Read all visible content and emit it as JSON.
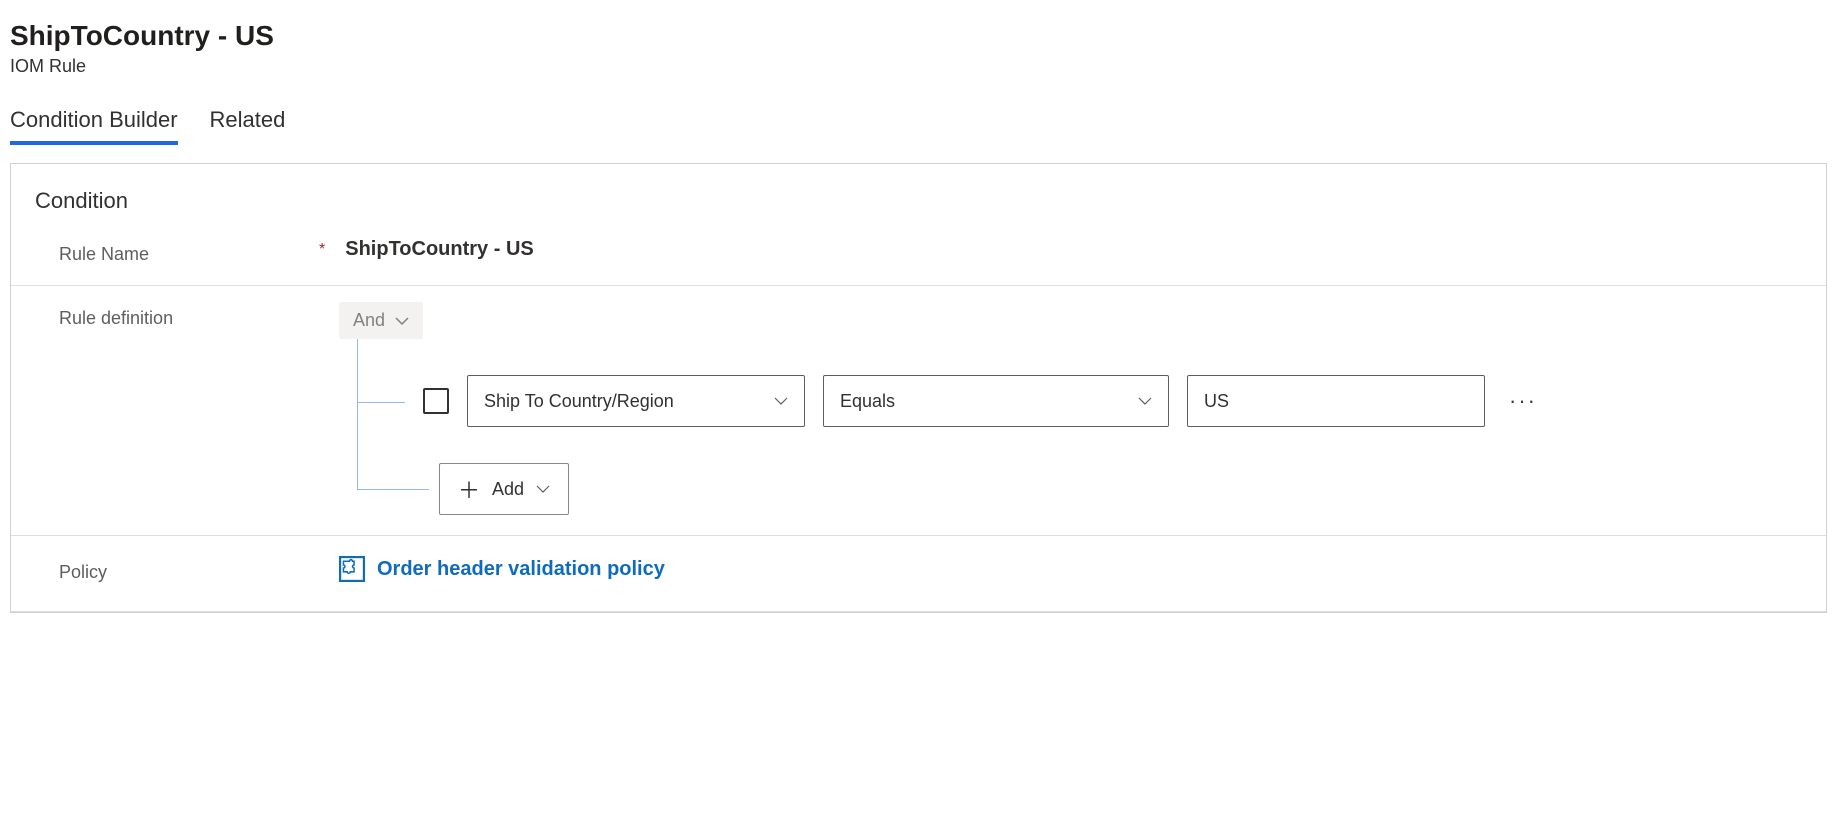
{
  "header": {
    "title": "ShipToCountry - US",
    "subtitle": "IOM Rule"
  },
  "tabs": {
    "condition_builder": "Condition Builder",
    "related": "Related"
  },
  "panel": {
    "heading": "Condition",
    "rule_name_label": "Rule Name",
    "rule_name_value": "ShipToCountry - US",
    "rule_definition_label": "Rule definition",
    "logical_operator": "And",
    "condition": {
      "field": "Ship To Country/Region",
      "operator": "Equals",
      "value": "US"
    },
    "add_label": "Add",
    "policy_label": "Policy",
    "policy_value": "Order header validation policy"
  }
}
